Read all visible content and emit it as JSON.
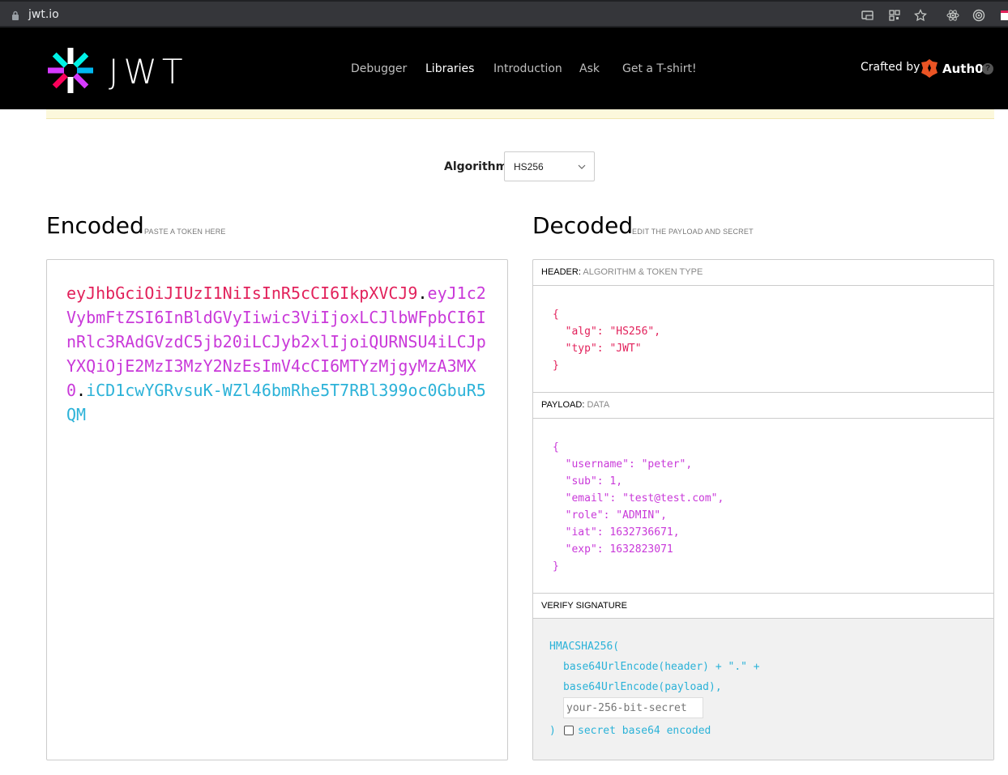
{
  "browser": {
    "url": "jwt.io"
  },
  "nav": {
    "items": [
      "Debugger",
      "Libraries",
      "Introduction",
      "Ask",
      "Get a T-shirt!"
    ],
    "active": "Libraries",
    "crafted_by": "Crafted by",
    "brand": "Auth0",
    "help": "?"
  },
  "logo": {
    "text": "JWT"
  },
  "algorithm": {
    "label": "Algorithm",
    "value": "HS256"
  },
  "encoded": {
    "title": "Encoded",
    "subtitle": "PASTE A TOKEN HERE",
    "header_part": "eyJhbGciOiJIUzI1NiIsInR5cCI6IkpXVCJ9",
    "payload_part": "eyJ1c2VybmFtZSI6InBldGVyIiwic3ViIjoxLCJlbWFpbCI6InRlc3RAdGVzdC5jb20iLCJyb2xlIjoiQURNSU4iLCJpYXQiOjE2MzI3MzY2NzEsImV4cCI6MTYzMjgyMzA3MX0",
    "signature_part": "iCD1cwYGRvsuK-WZl46bmRhe5T7RBl399oc0GbuR5QM",
    "dot": "."
  },
  "decoded": {
    "title": "Decoded",
    "subtitle": "EDIT THE PAYLOAD AND SECRET",
    "header_label": "HEADER:",
    "header_label_light": "ALGORITHM & TOKEN TYPE",
    "payload_label": "PAYLOAD:",
    "payload_label_light": "DATA",
    "verify_label": "VERIFY SIGNATURE",
    "header_json": {
      "open": "{",
      "close": "}",
      "alg_key": "\"alg\"",
      "alg_val": "\"HS256\"",
      "typ_key": "\"typ\"",
      "typ_val": "\"JWT\""
    },
    "payload_json": {
      "open": "{",
      "close": "}",
      "username_key": "\"username\"",
      "username_val": "\"peter\"",
      "sub_key": "\"sub\"",
      "sub_val": "1",
      "email_key": "\"email\"",
      "email_val": "\"test@test.com\"",
      "role_key": "\"role\"",
      "role_val": "\"ADMIN\"",
      "iat_key": "\"iat\"",
      "iat_val": "1632736671",
      "exp_key": "\"exp\"",
      "exp_val": "1632823071"
    },
    "signature": {
      "line1": "HMACSHA256(",
      "line2": "base64UrlEncode(header) + \".\" +",
      "line3": "base64UrlEncode(payload),",
      "secret_placeholder": "your-256-bit-secret",
      "close": ")",
      "checkbox_label": "secret base64 encoded"
    }
  },
  "colors": {
    "header": "#e2215b",
    "payload": "#c939d9",
    "signature": "#2bb2d8"
  }
}
